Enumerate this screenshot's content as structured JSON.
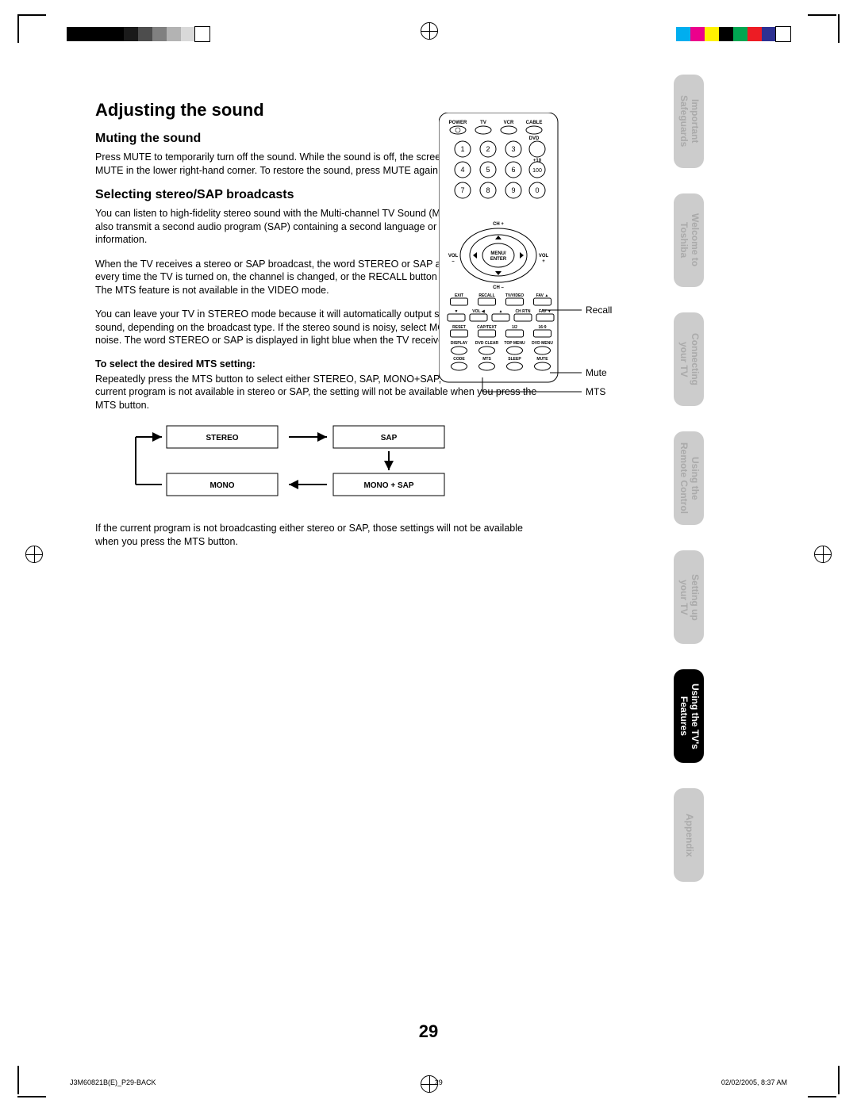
{
  "page_number": "29",
  "heading": "Adjusting the sound",
  "muting": {
    "title": "Muting the sound",
    "body": "Press MUTE to temporarily turn off the sound. While the sound is off, the screen will display the word MUTE in the lower right-hand corner. To restore the sound, press MUTE again."
  },
  "stereo": {
    "title": "Selecting stereo/SAP broadcasts",
    "p1": "You can listen to high-fidelity stereo sound with the Multi-channel TV Sound (MTS) feature. MTS can also transmit a second audio program (SAP) containing a second language or other audio information.",
    "p2": "When the TV receives a stereo or SAP broadcast, the word STEREO or SAP appears on-screen every time the TV is turned on, the channel is changed, or the RECALL button is pressed.\nThe MTS feature is not available in the VIDEO mode.",
    "p3": "You can leave your TV in STEREO mode because it will automatically output stereo or monaural sound, depending on the broadcast type. If the stereo sound is noisy, select MONO to reduce the noise. The word STEREO or SAP is displayed in light blue when the TV receives the signal.",
    "sub": "To select the desired MTS setting:",
    "p4": "Repeatedly press the MTS button to select either STEREO, SAP, MONO+SAP, or MONO. If the current program is not available in stereo or SAP, the setting will not be available when you press the MTS button.",
    "p5": "If the current program is not broadcasting either stereo or SAP, those settings will not be available when you press the MTS button."
  },
  "mts_boxes": {
    "tl": "STEREO",
    "tr": "SAP",
    "bl": "MONO",
    "br": "MONO + SAP"
  },
  "remote": {
    "top_labels": [
      "POWER",
      "TV",
      "VCR",
      "CABLE",
      "DVD"
    ],
    "numbers": [
      "1",
      "2",
      "3",
      "4",
      "5",
      "6",
      "7",
      "8",
      "9",
      "0"
    ],
    "plus10": "+10",
    "hundred": "100",
    "menu": "MENU/\nENTER",
    "ch_plus": "CH +",
    "ch_minus": "CH –",
    "vol_l": "VOL\n–",
    "vol_r": "VOL\n+",
    "row1": [
      "EXIT",
      "RECALL",
      "TV/VIDEO",
      "FAV ▲"
    ],
    "row2": [
      "▼",
      "VOL ◀",
      "▲",
      "CH RTN",
      "FAV ▼"
    ],
    "row3": [
      "RESET",
      "CAP/TEXT",
      "1/2",
      "16:9"
    ],
    "row4": [
      "DISPLAY",
      "DVD CLEAR",
      "TOP MENU",
      "DVD MENU"
    ],
    "row5": [
      "CODE",
      "MTS",
      "SLEEP",
      "MUTE"
    ],
    "callouts": {
      "recall": "Recall",
      "mute": "Mute",
      "mts": "MTS"
    }
  },
  "tabs": [
    {
      "l1": "Important",
      "l2": "Safeguards",
      "active": false
    },
    {
      "l1": "Welcome to",
      "l2": "Toshiba",
      "active": false
    },
    {
      "l1": "Connecting",
      "l2": "your TV",
      "active": false
    },
    {
      "l1": "Using the",
      "l2": "Remote Control",
      "active": false
    },
    {
      "l1": "Setting up",
      "l2": "your TV",
      "active": false
    },
    {
      "l1": "Using the TV's",
      "l2": "Features",
      "active": true
    },
    {
      "l1": "Appendix",
      "l2": "",
      "active": false
    }
  ],
  "footer": {
    "left": "J3M60821B(E)_P29-BACK",
    "mid": "29",
    "right": "02/02/2005, 8:37 AM"
  },
  "greys": [
    "#000",
    "#000",
    "#000",
    "#000",
    "#1a1a1a",
    "#4d4d4d",
    "#808080",
    "#b3b3b3",
    "#d9d9d9",
    "#fff"
  ],
  "colors": [
    "#00aeef",
    "#ec008c",
    "#fff200",
    "#000",
    "#00a651",
    "#ed1c24",
    "#2e3192",
    "#fff"
  ]
}
